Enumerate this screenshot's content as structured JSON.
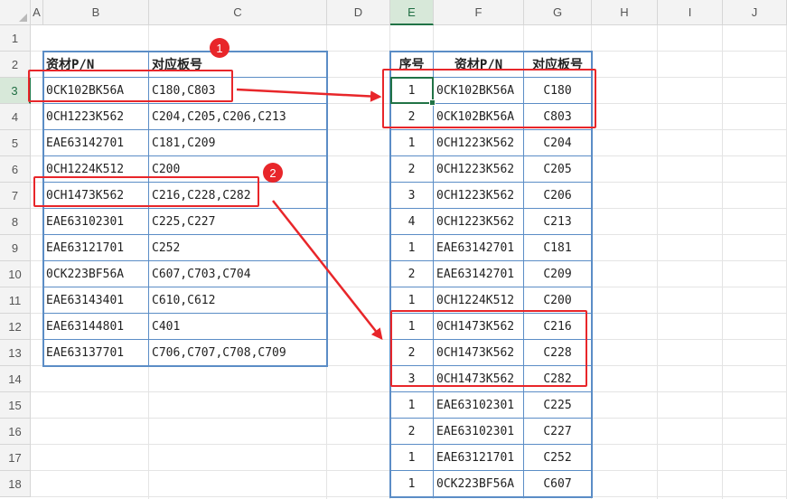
{
  "columns": [
    "A",
    "B",
    "C",
    "D",
    "E",
    "F",
    "G",
    "H",
    "I",
    "J"
  ],
  "active_column": "E",
  "rows": [
    "1",
    "2",
    "3",
    "4",
    "5",
    "6",
    "7",
    "8",
    "9",
    "10",
    "11",
    "12",
    "13",
    "14",
    "15",
    "16",
    "17",
    "18"
  ],
  "active_row": "3",
  "left_table": {
    "headers": [
      "资材P/N",
      "对应板号"
    ],
    "rows": [
      [
        "0CK102BK56A",
        "C180,C803"
      ],
      [
        "0CH1223K562",
        "C204,C205,C206,C213"
      ],
      [
        "EAE63142701",
        "C181,C209"
      ],
      [
        "0CH1224K512",
        "C200"
      ],
      [
        "0CH1473K562",
        "C216,C228,C282"
      ],
      [
        "EAE63102301",
        "C225,C227"
      ],
      [
        "EAE63121701",
        "C252"
      ],
      [
        "0CK223BF56A",
        "C607,C703,C704"
      ],
      [
        "EAE63143401",
        "C610,C612"
      ],
      [
        "EAE63144801",
        "C401"
      ],
      [
        "EAE63137701",
        "C706,C707,C708,C709"
      ]
    ]
  },
  "right_table": {
    "headers": [
      "序号",
      "资材P/N",
      "对应板号"
    ],
    "rows": [
      [
        "1",
        "0CK102BK56A",
        "C180"
      ],
      [
        "2",
        "0CK102BK56A",
        "C803"
      ],
      [
        "1",
        "0CH1223K562",
        "C204"
      ],
      [
        "2",
        "0CH1223K562",
        "C205"
      ],
      [
        "3",
        "0CH1223K562",
        "C206"
      ],
      [
        "4",
        "0CH1223K562",
        "C213"
      ],
      [
        "1",
        "EAE63142701",
        "C181"
      ],
      [
        "2",
        "EAE63142701",
        "C209"
      ],
      [
        "1",
        "0CH1224K512",
        "C200"
      ],
      [
        "1",
        "0CH1473K562",
        "C216"
      ],
      [
        "2",
        "0CH1473K562",
        "C228"
      ],
      [
        "3",
        "0CH1473K562",
        "C282"
      ],
      [
        "1",
        "EAE63102301",
        "C225"
      ],
      [
        "2",
        "EAE63102301",
        "C227"
      ],
      [
        "1",
        "EAE63121701",
        "C252"
      ],
      [
        "1",
        "0CK223BF56A",
        "C607"
      ]
    ]
  },
  "badges": [
    "1",
    "2"
  ],
  "colors": {
    "accent": "#217346",
    "annotation": "#e8262a",
    "table_border": "#5b8dc6"
  }
}
